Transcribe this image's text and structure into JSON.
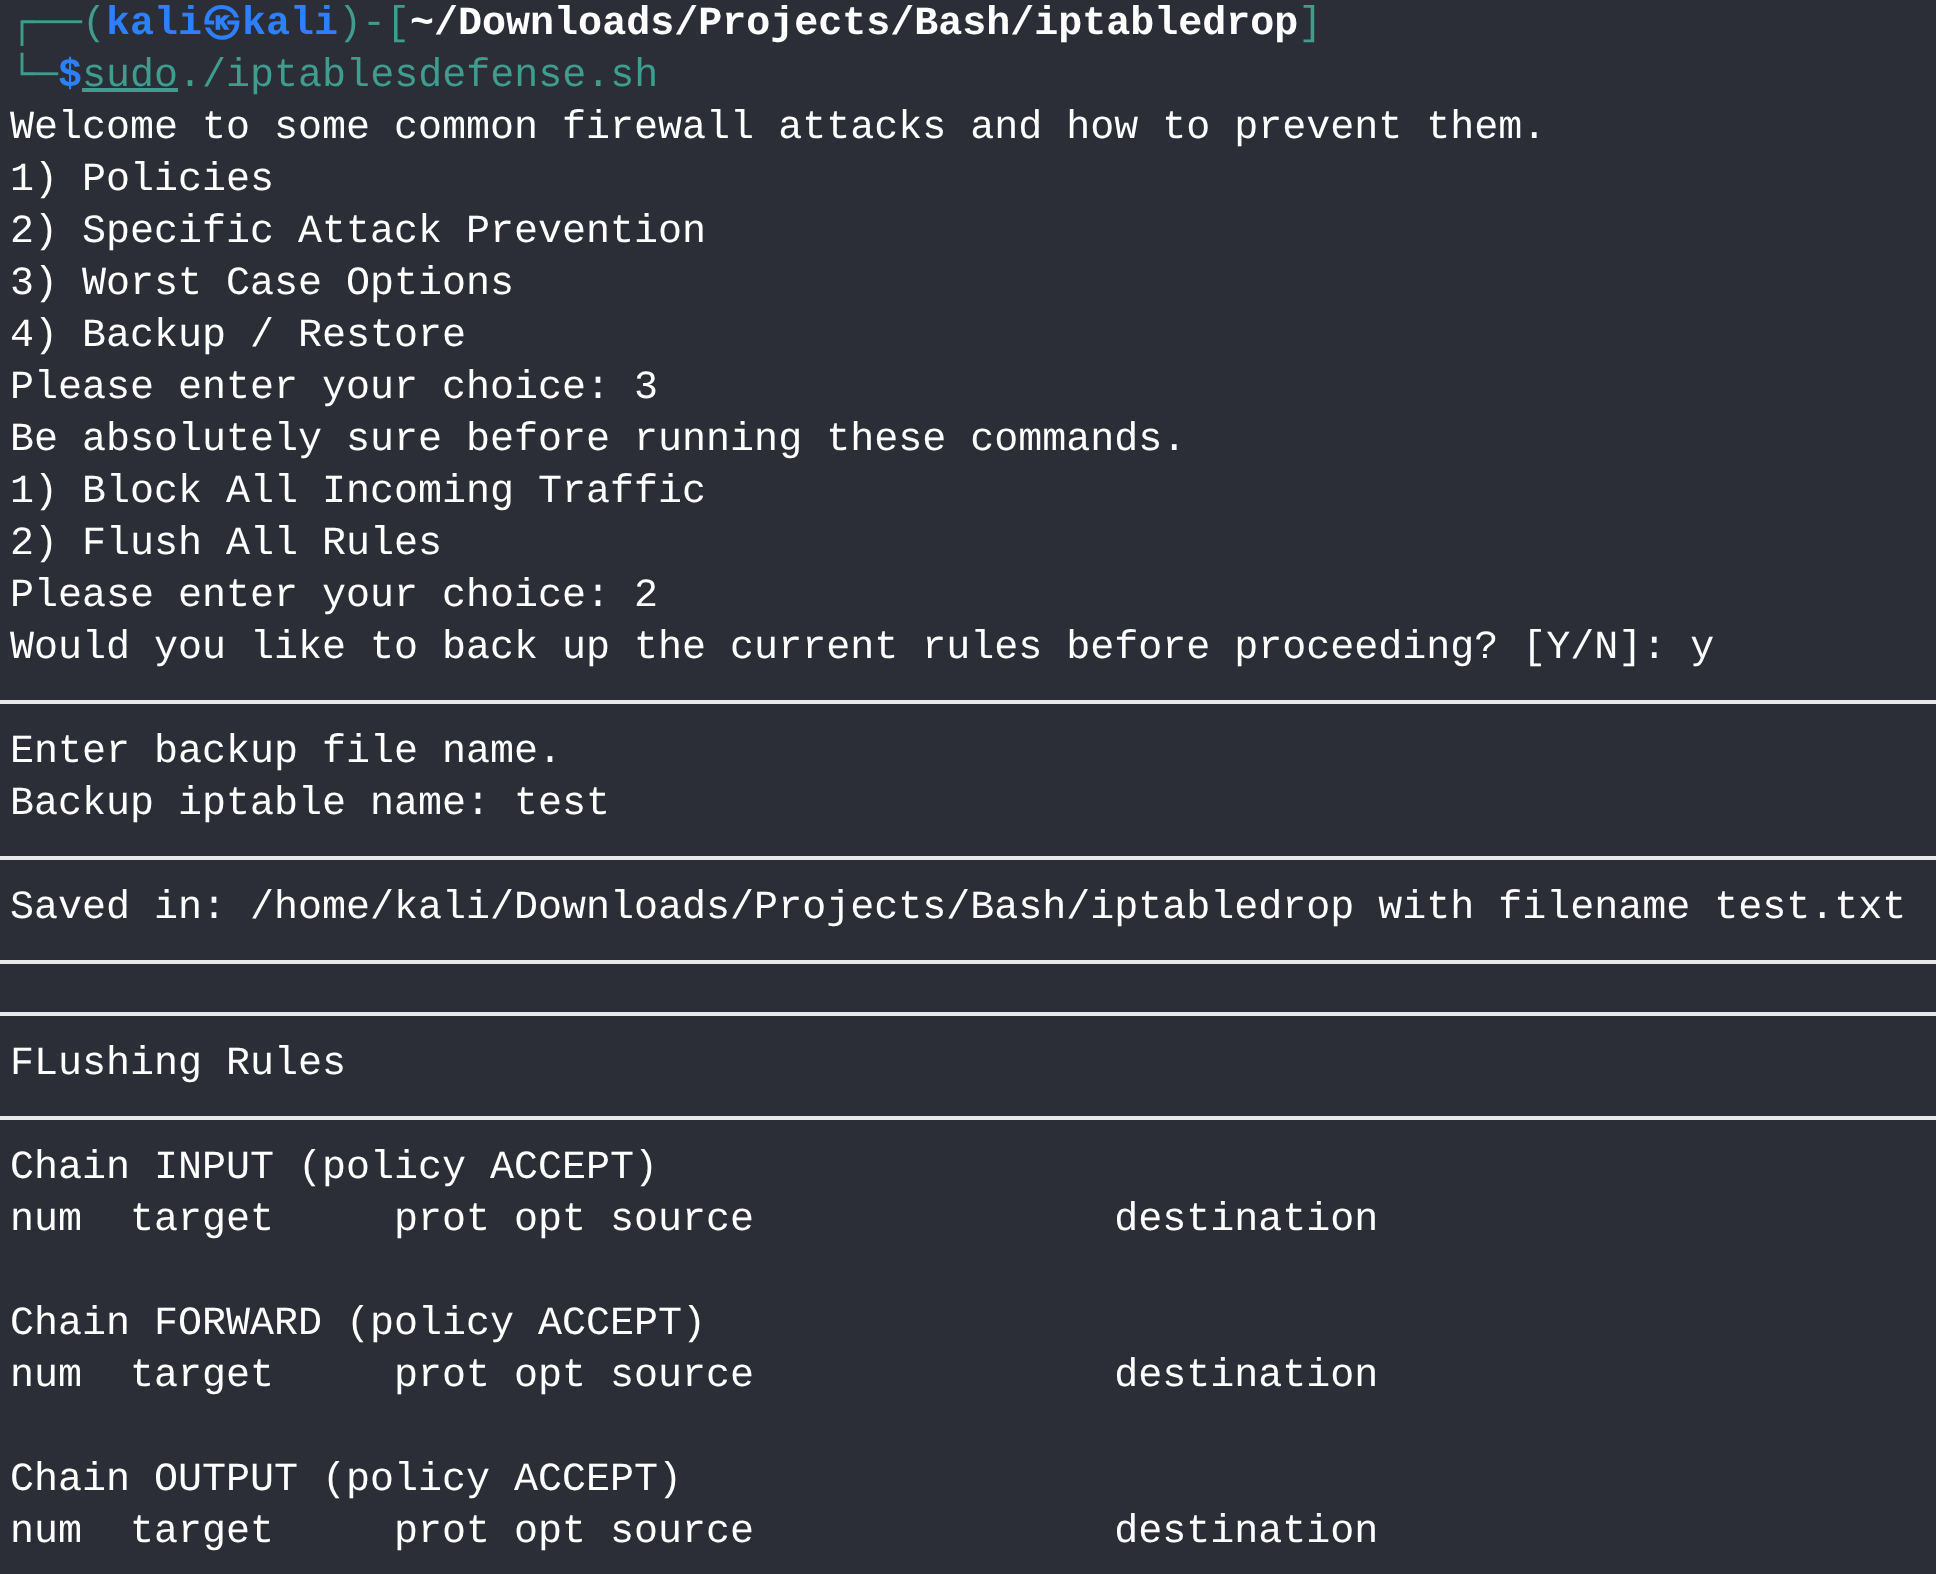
{
  "prompt": {
    "open": "┌──(",
    "user": "kali㉿kali",
    "mid": ")-[",
    "cwd": "~/Downloads/Projects/Bash/iptabledrop",
    "close": "]",
    "corner": "└─",
    "symbol": "$",
    "command": "sudo",
    "args": "./iptablesdefense.sh"
  },
  "lines": [
    {
      "kind": "text",
      "text": "Welcome to some common firewall attacks and how to prevent them."
    },
    {
      "kind": "text",
      "text": "1) Policies"
    },
    {
      "kind": "text",
      "text": "2) Specific Attack Prevention"
    },
    {
      "kind": "text",
      "text": "3) Worst Case Options"
    },
    {
      "kind": "text",
      "text": "4) Backup / Restore"
    },
    {
      "kind": "text",
      "text": "Please enter your choice: 3"
    },
    {
      "kind": "text",
      "text": "Be absolutely sure before running these commands."
    },
    {
      "kind": "text",
      "text": "1) Block All Incoming Traffic"
    },
    {
      "kind": "text",
      "text": "2) Flush All Rules"
    },
    {
      "kind": "text",
      "text": "Please enter your choice: 2"
    },
    {
      "kind": "text",
      "text": "Would you like to back up the current rules before proceeding? [Y/N]: y"
    },
    {
      "kind": "rule"
    },
    {
      "kind": "text",
      "text": "Enter backup file name."
    },
    {
      "kind": "text",
      "text": "Backup iptable name: test"
    },
    {
      "kind": "rule"
    },
    {
      "kind": "text",
      "text": "Saved in: /home/kali/Downloads/Projects/Bash/iptabledrop with filename test.txt"
    },
    {
      "kind": "rule"
    },
    {
      "kind": "rule"
    },
    {
      "kind": "text",
      "text": "FLushing Rules"
    },
    {
      "kind": "rule"
    },
    {
      "kind": "text",
      "text": "Chain INPUT (policy ACCEPT)"
    },
    {
      "kind": "text",
      "text": "num  target     prot opt source               destination"
    },
    {
      "kind": "blank"
    },
    {
      "kind": "text",
      "text": "Chain FORWARD (policy ACCEPT)"
    },
    {
      "kind": "text",
      "text": "num  target     prot opt source               destination"
    },
    {
      "kind": "blank"
    },
    {
      "kind": "text",
      "text": "Chain OUTPUT (policy ACCEPT)"
    },
    {
      "kind": "text",
      "text": "num  target     prot opt source               destination"
    }
  ]
}
